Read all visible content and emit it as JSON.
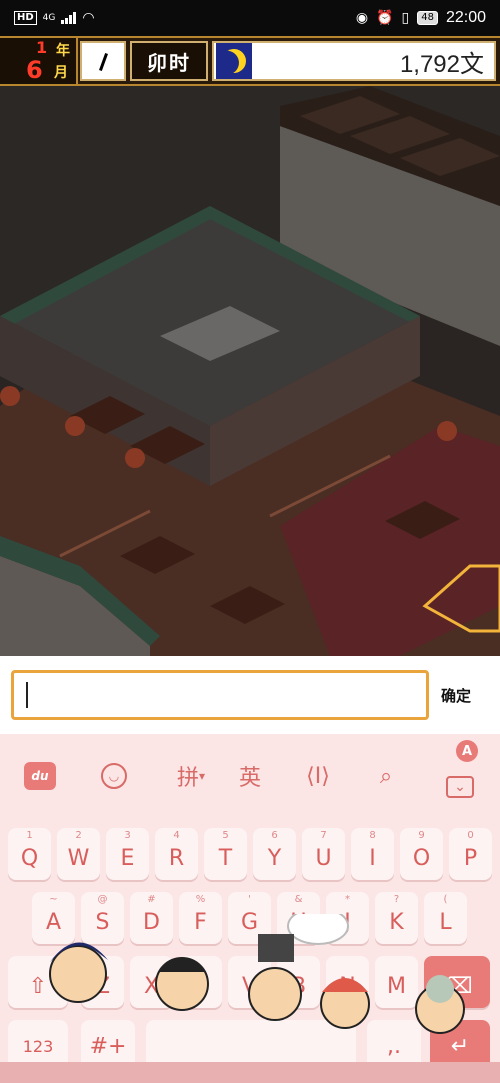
{
  "status_bar": {
    "hd": "HD",
    "network": "4G",
    "battery": "48",
    "time": "22:00"
  },
  "hud": {
    "year_num": "1",
    "year_unit": "年",
    "month_num": "6",
    "month_unit": "月",
    "period": "卯时",
    "money": "1,792文"
  },
  "input": {
    "value": "",
    "confirm_label": "确定"
  },
  "keyboard": {
    "toolbar": {
      "du_label": "du",
      "pinyin_label": "拼",
      "english_label": "英"
    },
    "row1": [
      {
        "key": "Q",
        "hint": "1"
      },
      {
        "key": "W",
        "hint": "2"
      },
      {
        "key": "E",
        "hint": "3"
      },
      {
        "key": "R",
        "hint": "4"
      },
      {
        "key": "T",
        "hint": "5"
      },
      {
        "key": "Y",
        "hint": "6"
      },
      {
        "key": "U",
        "hint": "7"
      },
      {
        "key": "I",
        "hint": "8"
      },
      {
        "key": "O",
        "hint": "9"
      },
      {
        "key": "P",
        "hint": "0"
      }
    ],
    "row2": [
      {
        "key": "A",
        "hint": "~"
      },
      {
        "key": "S",
        "hint": "@"
      },
      {
        "key": "D",
        "hint": "#"
      },
      {
        "key": "F",
        "hint": "%"
      },
      {
        "key": "G",
        "hint": "'"
      },
      {
        "key": "H",
        "hint": "&"
      },
      {
        "key": "J",
        "hint": "*"
      },
      {
        "key": "K",
        "hint": "?"
      },
      {
        "key": "L",
        "hint": "("
      }
    ],
    "row3": [
      {
        "key": "Z",
        "hint": ""
      },
      {
        "key": "X",
        "hint": ""
      },
      {
        "key": "C",
        "hint": ""
      },
      {
        "key": "V",
        "hint": ""
      },
      {
        "key": "B",
        "hint": ""
      },
      {
        "key": "N",
        "hint": ""
      },
      {
        "key": "M",
        "hint": ""
      }
    ],
    "numbers_label": "123",
    "colors": {
      "key_text": "#d85e5c",
      "background": "#fbe5e5",
      "accent": "#e87b78"
    }
  }
}
